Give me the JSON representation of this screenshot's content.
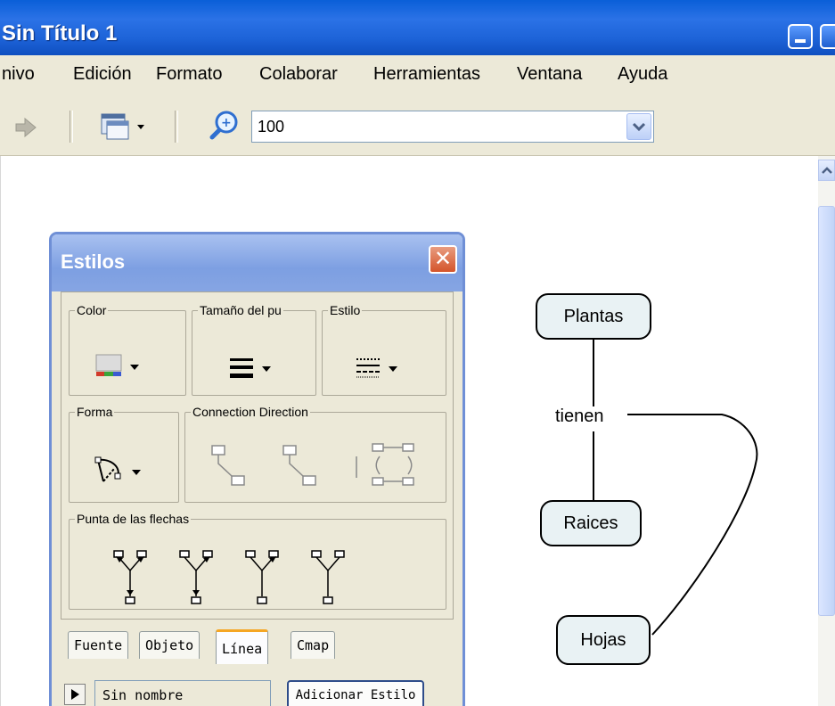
{
  "window": {
    "title": "Sin Título 1"
  },
  "menu": [
    "nivo",
    "Edición",
    "Formato",
    "Colaborar",
    "Herramientas",
    "Ventana",
    "Ayuda"
  ],
  "toolbar": {
    "zoom_value": "100"
  },
  "concept_map": {
    "nodes": [
      "Plantas",
      "Raices",
      "Hojas"
    ],
    "linking_phrase": "tienen"
  },
  "styles_panel": {
    "title": "Estilos",
    "groups": {
      "color": "Color",
      "size": "Tamaño del pu",
      "style": "Estilo",
      "shape": "Forma",
      "connection": "Connection Direction",
      "arrowheads": "Punta de las flechas"
    },
    "tabs": [
      "Fuente",
      "Objeto",
      "Línea",
      "Cmap"
    ],
    "active_tab": "Línea",
    "style_name": "Sin nombre",
    "add_style_label": "Adicionar Estilo"
  },
  "colors": {
    "title_bar": "#2b72e6",
    "panel_title": "#7d9fe2",
    "node_fill": "#e9f2f4",
    "tab_accent": "#f5a623",
    "close": "#d4542a"
  }
}
